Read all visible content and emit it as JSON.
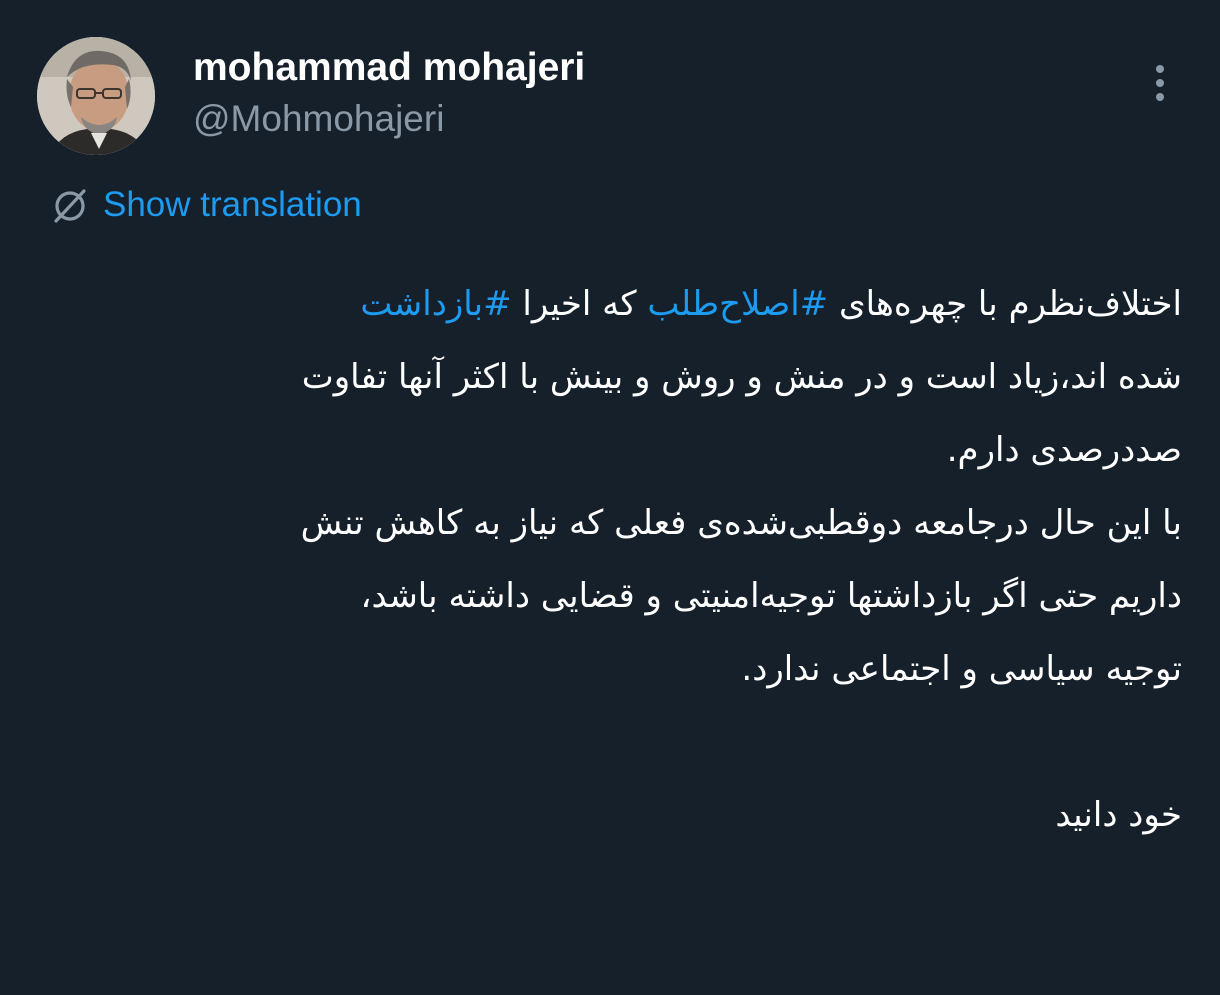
{
  "author": {
    "display_name": "mohammad mohajeri",
    "handle": "@Mohmohajeri",
    "avatar_icon": "person-photo"
  },
  "menu": {
    "icon": "more-vertical-icon"
  },
  "translation": {
    "icon": "globe-translate-icon",
    "label": "Show translation"
  },
  "tweet": {
    "line1": {
      "before": "اختلاف‌نظرم با چهره‌های ",
      "hashtag1": "#اصلاح‌طلب",
      "middle": " که اخیرا ",
      "hashtag2": "#بازداشت"
    },
    "lines": [
      "شده اند،زیاد است و در منش و روش و بینش با اکثر آنها تفاوت",
      "صددرصدی دارم.",
      "با این حال درجامعه دوقطبی‌شده‌ی فعلی که نیاز به کاهش تنش",
      "داریم حتی اگر بازداشتها توجیه‌امنیتی و قضایی داشته باشد،",
      "توجیه سیاسی و اجتماعی ندارد."
    ],
    "closing": "خود دانید"
  },
  "colors": {
    "background": "#15202b",
    "text": "#ffffff",
    "secondary": "#8b98a5",
    "accent": "#1d9bf0"
  }
}
